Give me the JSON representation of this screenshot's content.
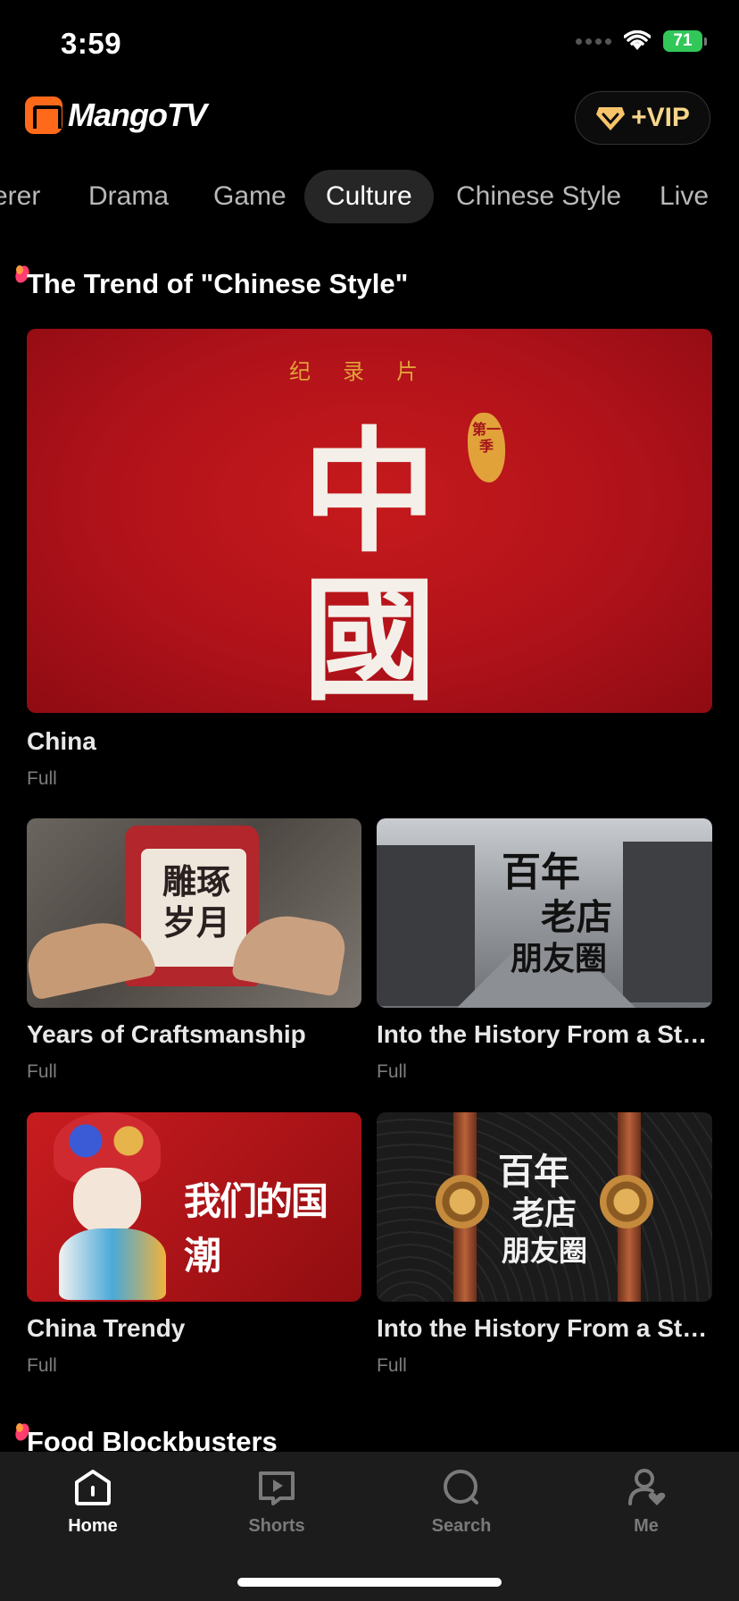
{
  "status_bar": {
    "time": "3:59",
    "battery": "71"
  },
  "header": {
    "logo_text": "MangoTV",
    "vip_label": "+VIP"
  },
  "tabs": [
    {
      "label": "erer"
    },
    {
      "label": "Drama"
    },
    {
      "label": "Game"
    },
    {
      "label": "Culture",
      "active": true
    },
    {
      "label": "Chinese Style"
    },
    {
      "label": "Live"
    }
  ],
  "sections": [
    {
      "title": "The Trend of \"Chinese Style\"",
      "featured": {
        "title": "China",
        "subtitle": "Full",
        "poster_doc": "纪录片",
        "poster_char1": "中",
        "poster_char2": "國",
        "poster_season": "第一季"
      },
      "cards": [
        {
          "title": "Years of Craftsmanship",
          "subtitle": "Full",
          "poster_text": "雕琢岁月"
        },
        {
          "title": "Into the History From a Store",
          "subtitle": "Full",
          "poster_text_1": "百年",
          "poster_text_2": "老店",
          "poster_text_3": "朋友圈"
        },
        {
          "title": "China Trendy",
          "subtitle": "Full",
          "poster_text": "我们的国潮"
        },
        {
          "title": "Into the History From a Store",
          "subtitle": "Full",
          "poster_text_1": "百年",
          "poster_text_2": "老店",
          "poster_text_3": "朋友圈"
        }
      ]
    },
    {
      "title": "Food Blockbusters"
    }
  ],
  "bottom_nav": [
    {
      "label": "Home",
      "icon": "home-icon",
      "active": true
    },
    {
      "label": "Shorts",
      "icon": "shorts-icon"
    },
    {
      "label": "Search",
      "icon": "search-icon"
    },
    {
      "label": "Me",
      "icon": "profile-icon"
    }
  ],
  "colors": {
    "accent": "#ff6a1a",
    "vip_gold": "#f7d58a",
    "background": "#000000",
    "nav_bg": "#1c1c1c"
  }
}
